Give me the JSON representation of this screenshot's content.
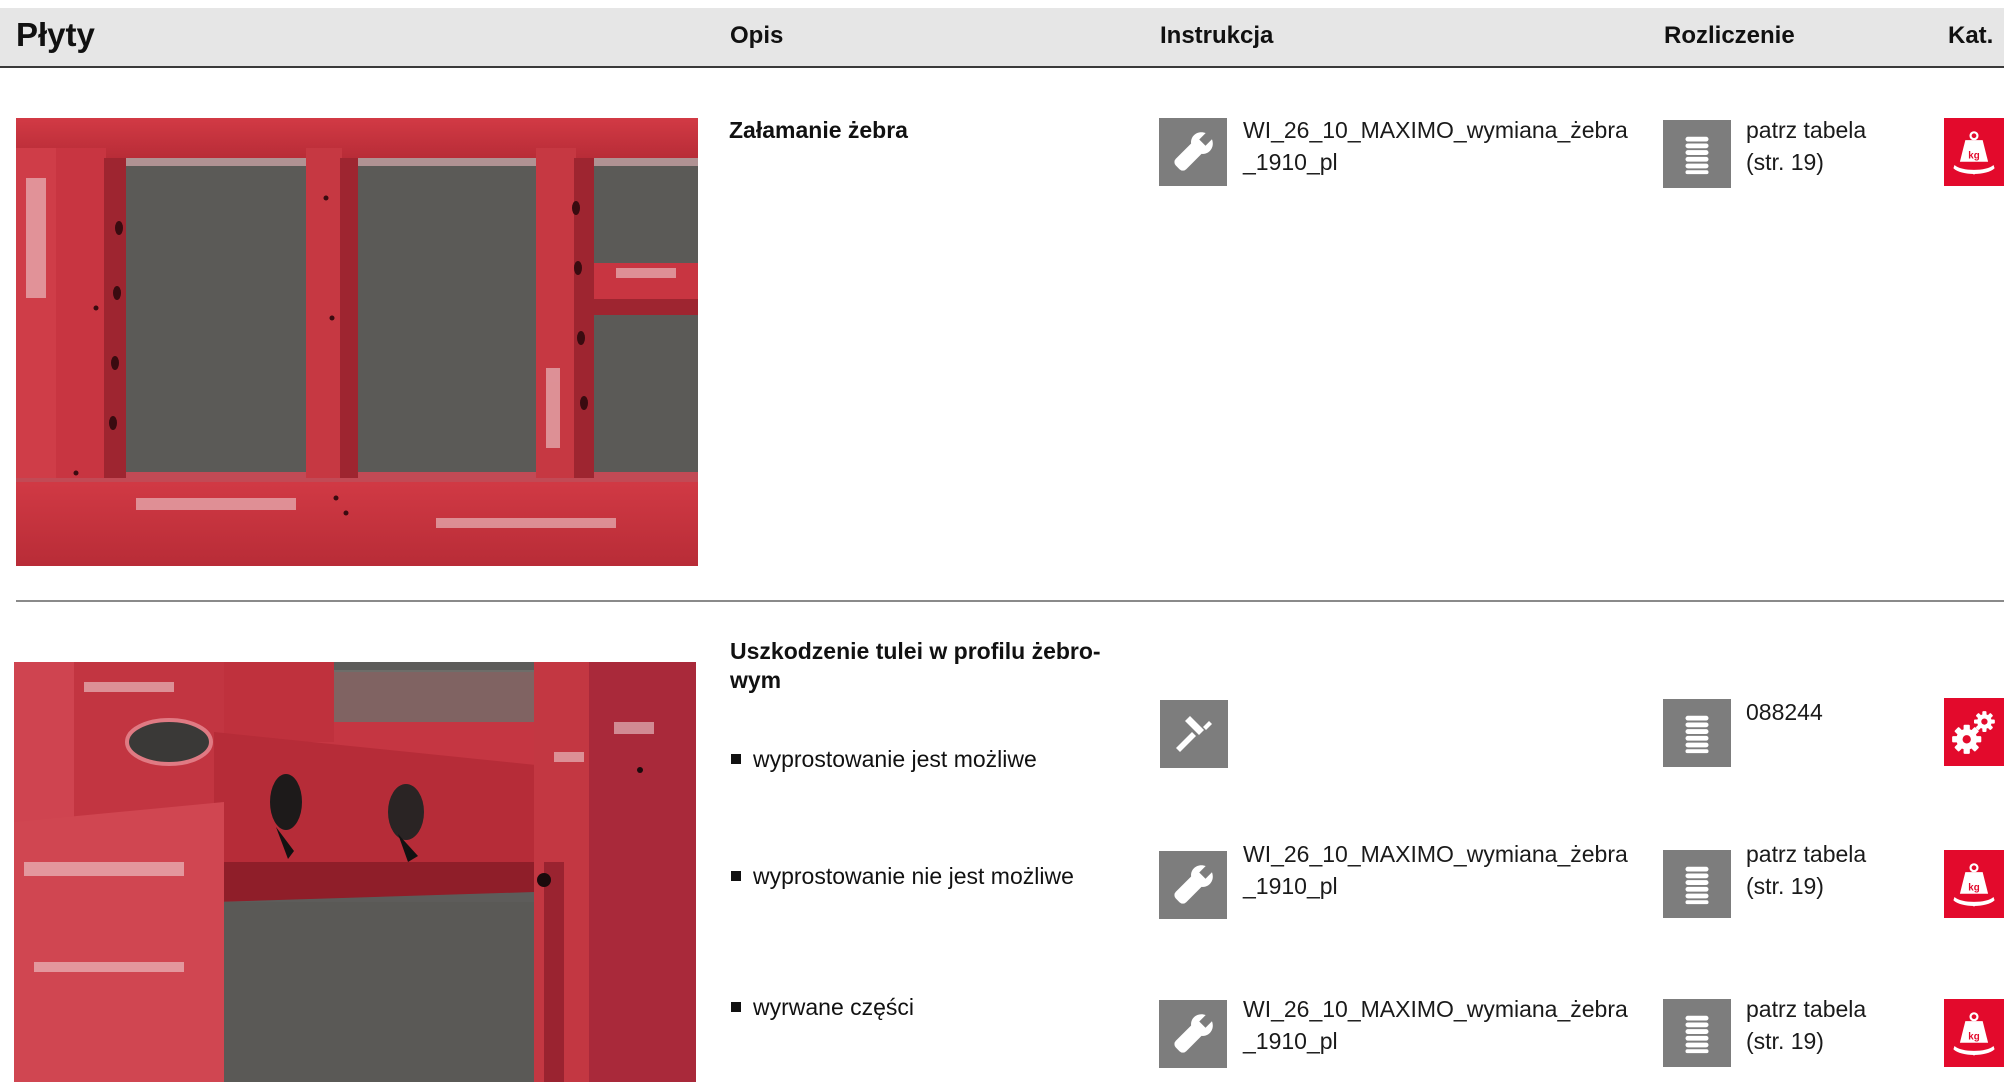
{
  "header": {
    "title": "Płyty",
    "col_opis": "Opis",
    "col_instrukcja": "Instrukcja",
    "col_rozliczenie": "Rozliczenie",
    "col_kat": "Kat."
  },
  "colors": {
    "accent_red": "#e30a2c",
    "icon_gray": "#7d7d7d",
    "header_bg": "#e6e6e6"
  },
  "section1": {
    "title": "Załamanie żebra",
    "instruction": {
      "icon": "wrench-icon",
      "line1": "WI_26_10_MAXIMO_wymiana_żebra",
      "line2": "_1910_pl"
    },
    "billing": {
      "icon": "coin-stack-icon",
      "line1": "patrz tabela",
      "line2": "(str. 19)"
    },
    "category_icon": "weight-kg-icon"
  },
  "section2": {
    "title_line1": "Uszkodzenie tulei w profilu żebro-",
    "title_line2": "wym",
    "rows": [
      {
        "bullet": "wyprostowanie jest możliwe",
        "instruction_icon": "hammer-icon",
        "billing": {
          "icon": "coin-stack-icon",
          "line1": "088244"
        },
        "category_icon": "gears-icon"
      },
      {
        "bullet": "wyprostowanie nie jest możliwe",
        "instruction": {
          "icon": "wrench-icon",
          "line1": "WI_26_10_MAXIMO_wymiana_żebra",
          "line2": "_1910_pl"
        },
        "billing": {
          "icon": "coin-stack-icon",
          "line1": "patrz tabela",
          "line2": "(str. 19)"
        },
        "category_icon": "weight-kg-icon"
      },
      {
        "bullet": "wyrwane części",
        "instruction": {
          "icon": "wrench-icon",
          "line1": "WI_26_10_MAXIMO_wymiana_żebra",
          "line2": "_1910_pl"
        },
        "billing": {
          "icon": "coin-stack-icon",
          "line1": "patrz tabela",
          "line2": "(str. 19)"
        },
        "category_icon": "weight-kg-icon"
      }
    ]
  }
}
